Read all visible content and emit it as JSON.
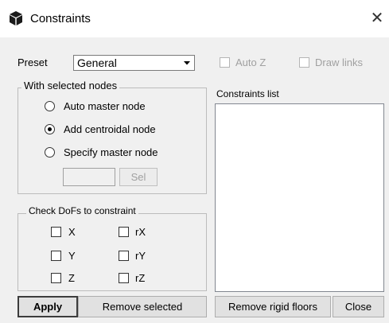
{
  "window": {
    "title": "Constraints",
    "close_symbol": "✕",
    "icon": "cube-icon"
  },
  "preset": {
    "label": "Preset",
    "value": "General"
  },
  "auto_z": {
    "label": "Auto Z",
    "checked": false,
    "enabled": false
  },
  "draw_links": {
    "label": "Draw links",
    "checked": false,
    "enabled": false
  },
  "selected_nodes": {
    "legend": "With selected nodes",
    "options": [
      {
        "label": "Auto master node",
        "selected": false
      },
      {
        "label": "Add centroidal node",
        "selected": true
      },
      {
        "label": "Specify master node",
        "selected": false
      }
    ],
    "master_node_value": "",
    "sel_button": "Sel"
  },
  "constraints_list": {
    "label": "Constraints list",
    "items": []
  },
  "dofs": {
    "legend": "Check DoFs to constraint",
    "items": [
      {
        "label": "X",
        "checked": false
      },
      {
        "label": "rX",
        "checked": false
      },
      {
        "label": "Y",
        "checked": false
      },
      {
        "label": "rY",
        "checked": false
      },
      {
        "label": "Z",
        "checked": false
      },
      {
        "label": "rZ",
        "checked": false
      }
    ]
  },
  "buttons": {
    "apply": "Apply",
    "remove_selected": "Remove selected",
    "remove_rigid_floors": "Remove rigid floors",
    "close": "Close"
  }
}
